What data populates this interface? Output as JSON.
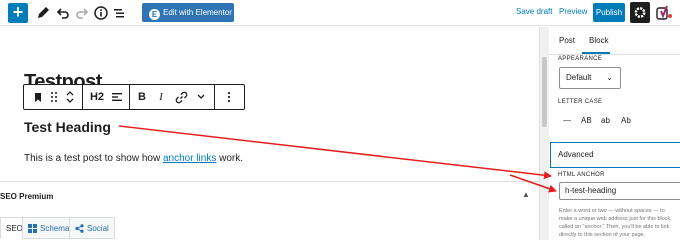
{
  "toolbar": {
    "add_label": "+",
    "elementor_label": "Edit with Elementor",
    "elementor_icon_glyph": "E",
    "save_draft_label": "Save draft",
    "preview_label": "Preview",
    "publish_label": "Publish"
  },
  "editor": {
    "post_title": "Testpost",
    "block_toolbar": {
      "heading_level": "H2",
      "bold": "B",
      "italic": "I"
    },
    "heading": "Test Heading",
    "paragraph": {
      "before": "This is a test post to show how ",
      "link": "anchor links",
      "after": " work."
    }
  },
  "seo_box": {
    "title": "SEO Premium",
    "tabs": [
      {
        "label": "SEO"
      },
      {
        "label": "Schema"
      },
      {
        "label": "Social"
      }
    ]
  },
  "sidebar": {
    "tabs": [
      {
        "label": "Post"
      },
      {
        "label": "Block"
      }
    ],
    "active_tab": "Block",
    "appearance_label": "APPEARANCE",
    "appearance_value": "Default",
    "letter_case_label": "LETTER CASE",
    "letter_case_options": [
      "—",
      "AB",
      "ab",
      "Ab"
    ],
    "advanced_label": "Advanced",
    "html_anchor_label": "HTML ANCHOR",
    "html_anchor_value": "h-test-heading",
    "help_lines": [
      "Enter a word or two — without spaces — to",
      "make a unique web address just for this block,",
      "called an \"anchor.\" Then, you'll be able to link",
      "directly to this section of your page."
    ]
  },
  "colors": {
    "accent": "#007cba",
    "elementor": "#2f75b5",
    "annotation": "#e41e1e"
  }
}
